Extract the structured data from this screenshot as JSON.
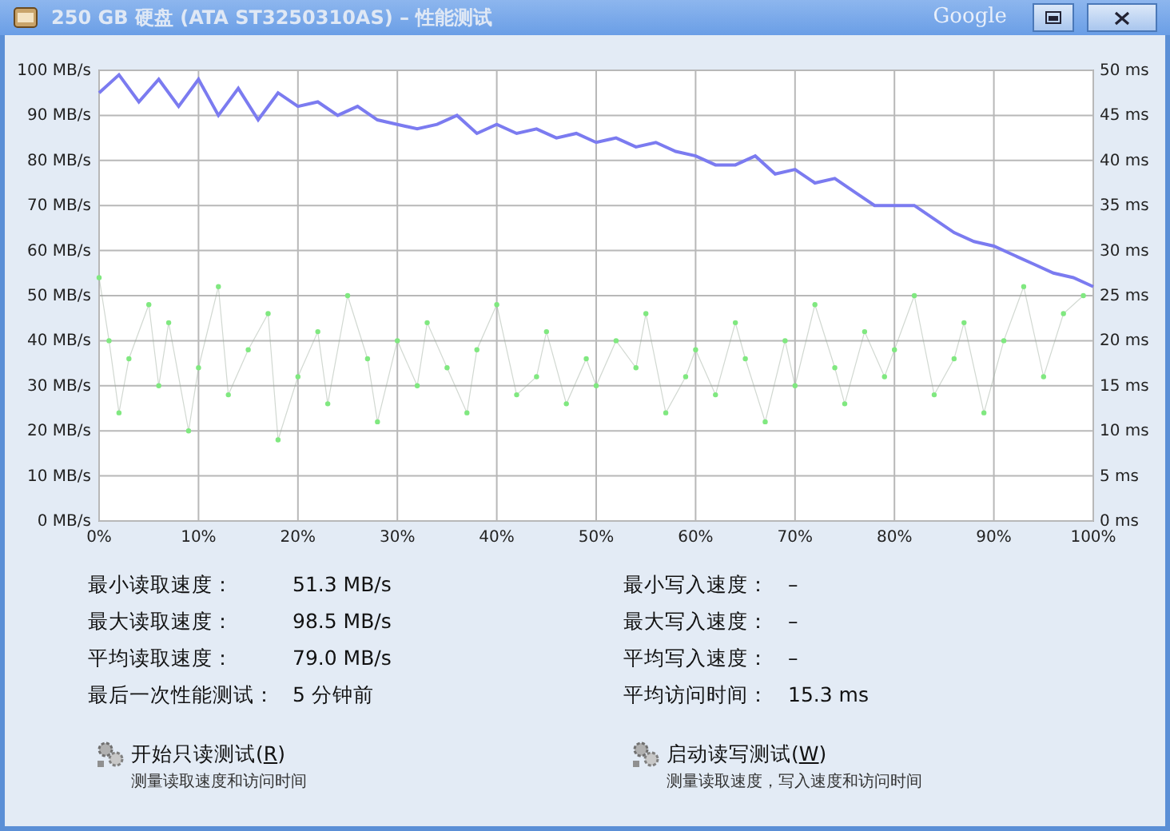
{
  "window": {
    "title": "250 GB 硬盘 (ATA ST3250310AS) – 性能测试",
    "brand": "Google"
  },
  "chart": {
    "chart_data": {
      "type": "line",
      "xticks": [
        {
          "value": 0,
          "label": "0%"
        },
        {
          "value": 10,
          "label": "10%"
        },
        {
          "value": 20,
          "label": "20%"
        },
        {
          "value": 30,
          "label": "30%"
        },
        {
          "value": 40,
          "label": "40%"
        },
        {
          "value": 50,
          "label": "50%"
        },
        {
          "value": 60,
          "label": "60%"
        },
        {
          "value": 70,
          "label": "70%"
        },
        {
          "value": 80,
          "label": "80%"
        },
        {
          "value": 90,
          "label": "90%"
        },
        {
          "value": 100,
          "label": "100%"
        }
      ],
      "yticks": [
        {
          "value": 0,
          "label": "0 MB/s"
        },
        {
          "value": 10,
          "label": "10 MB/s"
        },
        {
          "value": 20,
          "label": "20 MB/s"
        },
        {
          "value": 30,
          "label": "30 MB/s"
        },
        {
          "value": 40,
          "label": "40 MB/s"
        },
        {
          "value": 50,
          "label": "50 MB/s"
        },
        {
          "value": 60,
          "label": "60 MB/s"
        },
        {
          "value": 70,
          "label": "70 MB/s"
        },
        {
          "value": 80,
          "label": "80 MB/s"
        },
        {
          "value": 90,
          "label": "90 MB/s"
        },
        {
          "value": 100,
          "label": "100 MB/s"
        }
      ],
      "y2ticks": [
        {
          "value": 0,
          "label": "0 ms"
        },
        {
          "value": 5,
          "label": "5 ms"
        },
        {
          "value": 10,
          "label": "10 ms"
        },
        {
          "value": 15,
          "label": "15 ms"
        },
        {
          "value": 20,
          "label": "20 ms"
        },
        {
          "value": 25,
          "label": "25 ms"
        },
        {
          "value": 30,
          "label": "30 ms"
        },
        {
          "value": 35,
          "label": "35 ms"
        },
        {
          "value": 40,
          "label": "40 ms"
        },
        {
          "value": 45,
          "label": "45 ms"
        },
        {
          "value": 50,
          "label": "50 ms"
        }
      ],
      "grid": true,
      "xlim": [
        0,
        100
      ],
      "ylim": [
        0,
        100
      ],
      "y2lim": [
        0,
        50
      ],
      "series": [
        {
          "color": "#7b7bf0",
          "x": [
            0,
            2,
            4,
            6,
            8,
            10,
            12,
            14,
            16,
            18,
            20,
            22,
            24,
            26,
            28,
            30,
            32,
            34,
            36,
            38,
            40,
            42,
            44,
            46,
            48,
            50,
            52,
            54,
            56,
            58,
            60,
            62,
            64,
            66,
            68,
            70,
            72,
            74,
            76,
            78,
            80,
            82,
            84,
            86,
            88,
            90,
            92,
            94,
            96,
            98,
            100
          ],
          "values": [
            95,
            99,
            93,
            98,
            92,
            98,
            90,
            96,
            89,
            95,
            92,
            93,
            90,
            92,
            89,
            88,
            87,
            88,
            90,
            86,
            88,
            86,
            87,
            85,
            86,
            84,
            85,
            83,
            84,
            82,
            81,
            79,
            79,
            81,
            77,
            78,
            75,
            76,
            73,
            70,
            70,
            70,
            67,
            64,
            62,
            61,
            59,
            57,
            55,
            54,
            52
          ]
        },
        {
          "color": "#80e880",
          "axis": "y2",
          "marker": "circle",
          "x": [
            0,
            1,
            2,
            3,
            5,
            6,
            7,
            9,
            10,
            12,
            13,
            15,
            17,
            18,
            20,
            22,
            23,
            25,
            27,
            28,
            30,
            32,
            33,
            35,
            37,
            38,
            40,
            42,
            44,
            45,
            47,
            49,
            50,
            52,
            54,
            55,
            57,
            59,
            60,
            62,
            64,
            65,
            67,
            69,
            70,
            72,
            74,
            75,
            77,
            79,
            80,
            82,
            84,
            86,
            87,
            89,
            91,
            93,
            95,
            97,
            99
          ],
          "values": [
            27,
            20,
            12,
            18,
            24,
            15,
            22,
            10,
            17,
            26,
            14,
            19,
            23,
            9,
            16,
            21,
            13,
            25,
            18,
            11,
            20,
            15,
            22,
            17,
            12,
            19,
            24,
            14,
            16,
            21,
            13,
            18,
            15,
            20,
            17,
            23,
            12,
            16,
            19,
            14,
            22,
            18,
            11,
            20,
            15,
            24,
            17,
            13,
            21,
            16,
            19,
            25,
            14,
            18,
            22,
            12,
            20,
            26,
            16,
            23,
            25
          ]
        }
      ]
    }
  },
  "stats": [
    {
      "label": "最小读取速度：",
      "value": "51.3 MB/s"
    },
    {
      "label": "最小写入速度：",
      "value": "–"
    },
    {
      "label": "最大读取速度：",
      "value": "98.5 MB/s"
    },
    {
      "label": "最大写入速度：",
      "value": "–"
    },
    {
      "label": "平均读取速度：",
      "value": "79.0 MB/s"
    },
    {
      "label": "平均写入速度：",
      "value": "–"
    },
    {
      "label": "最后一次性能测试：",
      "value": "5 分钟前"
    },
    {
      "label": "平均访问时间：",
      "value": "15.3 ms"
    }
  ],
  "actions": [
    {
      "title": "开始只读测试(",
      "key": "R",
      "close": ")",
      "description": "测量读取速度和访问时间"
    },
    {
      "title": "启动读写测试(",
      "key": "W",
      "close": ")",
      "description": "测量读取速度，写入速度和访问时间"
    }
  ]
}
